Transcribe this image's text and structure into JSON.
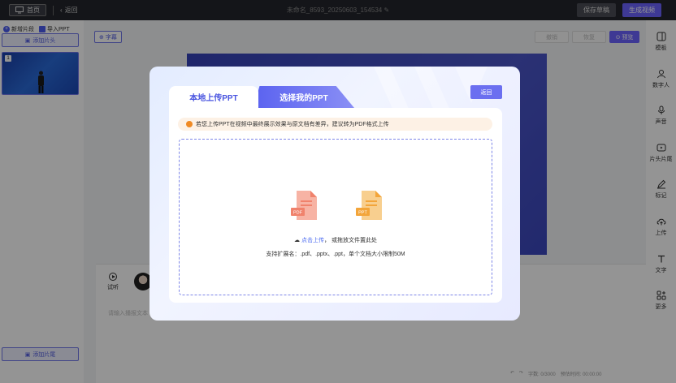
{
  "topbar": {
    "home_label": "首页",
    "back_label": "返回",
    "doc_title": "未命名_8593_20250603_154534",
    "save_draft_label": "保存草稿",
    "generate_video_label": "生成视频"
  },
  "left_panel": {
    "new_segment_label": "新增片段",
    "import_ppt_label": "导入PPT",
    "add_head_label": "添加片头",
    "add_tail_label": "添加片尾",
    "slides": [
      {
        "number": "1"
      }
    ]
  },
  "toolbar": {
    "subtitle_label": "字幕",
    "undo_label": "撤销",
    "redo_label": "恢复",
    "preview_label": "预览"
  },
  "script": {
    "audition_label": "试听",
    "placeholder": "请输入播报文本",
    "word_count": "字数: 0/3000",
    "estimated_time": "预估时间: 00:00:00"
  },
  "right_panel": {
    "items": [
      {
        "label": "模板",
        "icon": "template-icon"
      },
      {
        "label": "数字人",
        "icon": "person-icon"
      },
      {
        "label": "声音",
        "icon": "microphone-icon"
      },
      {
        "label": "片头片尾",
        "icon": "video-play-icon"
      },
      {
        "label": "标记",
        "icon": "pen-icon"
      },
      {
        "label": "上传",
        "icon": "cloud-upload-icon"
      },
      {
        "label": "文字",
        "icon": "text-icon"
      },
      {
        "label": "更多",
        "icon": "grid-more-icon"
      }
    ]
  },
  "modal": {
    "tab_local": "本地上传PPT",
    "tab_mine": "选择我的PPT",
    "return_label": "返回",
    "notice": "若您上传PPT在视频中最终展示效果与原文档有差异，建议转为PDF格式上传",
    "file_pdf_tag": "PDF",
    "file_ppt_tag": "PPT",
    "upload_link": "点击上传",
    "upload_rest": "，  或拖放文件置此处",
    "support_text": "支持扩展名：.pdf、.pptx、.ppt，单个文档大小限制50M"
  },
  "colors": {
    "accent": "#6b63ff",
    "link": "#4a6af0",
    "topbar_bg": "#23252c",
    "notice_bg": "#fdf1e5",
    "pdf_icon": "#f0826c",
    "ppt_icon": "#f3a53a"
  }
}
